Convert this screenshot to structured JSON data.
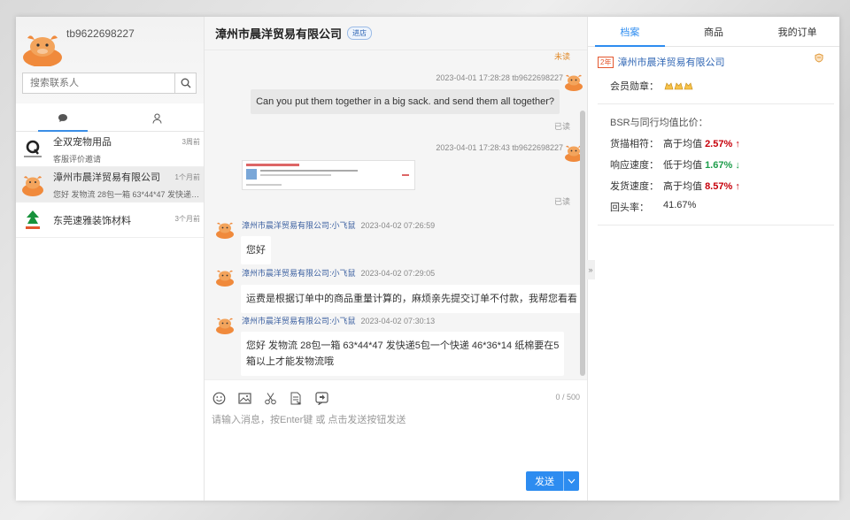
{
  "me": {
    "name": "tb9622698227"
  },
  "search": {
    "placeholder": "搜索联系人"
  },
  "contacts": [
    {
      "name": "全双宠物用品",
      "subtitle": "客服评价邀请",
      "time": "3周前"
    },
    {
      "name": "漳州市晨洋贸易有限公司",
      "subtitle": "您好 发物流 28包一箱 63*44*47 发快递5包...",
      "time": "1个月前"
    },
    {
      "name": "东莞速雅装饰材料",
      "subtitle": "",
      "time": "3个月前"
    }
  ],
  "chat": {
    "title": "漳州市晨洋贸易有限公司",
    "badge": "进店",
    "unread": "未读",
    "messages": [
      {
        "meta": "2023-04-01 17:28:28  tb9622698227",
        "text": "Can you put them together in a big sack. and send them all together?",
        "status": "已读"
      },
      {
        "meta": "2023-04-01 17:28:43  tb9622698227",
        "status": "已读"
      },
      {
        "who": "漳州市晨洋贸易有限公司:小飞鼠",
        "time": "2023-04-02 07:26:59",
        "text": "您好"
      },
      {
        "who": "漳州市晨洋贸易有限公司:小飞鼠",
        "time": "2023-04-02 07:29:05",
        "text": "运费是根据订单中的商品重量计算的，麻烦亲先提交订单不付款，我帮您看看"
      },
      {
        "who": "漳州市晨洋贸易有限公司:小飞鼠",
        "time": "2023-04-02 07:30:13",
        "text_line1": "您好  发物流 28包一箱   63*44*47     发快递5包一个快递   46*36*14    纸棉要在5",
        "text_line2": "箱以上才能发物流哦"
      }
    ],
    "counter": "0 / 500",
    "placeholder": "请输入消息，按Enter键 或 点击发送按钮发送",
    "send": "发送"
  },
  "panel": {
    "tabs": [
      "档案",
      "商品",
      "我的订单"
    ],
    "years": "2年",
    "shop": "漳州市晨洋贸易有限公司",
    "medal_label": "会员勋章：",
    "bsr_title": "BSR与同行均值比价：",
    "rows": [
      {
        "k": "货描相符：",
        "v": "高于均值 ",
        "n": "2.57%",
        "dir": "up"
      },
      {
        "k": "响应速度：",
        "v": "低于均值 ",
        "n": "1.67%",
        "dir": "down"
      },
      {
        "k": "发货速度：",
        "v": "高于均值 ",
        "n": "8.57%",
        "dir": "up"
      },
      {
        "k": "回头率：",
        "v": "41.67%",
        "n": "",
        "dir": ""
      }
    ]
  },
  "colors": {
    "accent": "#2d8cf0",
    "mascot": "#f08a3c",
    "up": "#c7000b",
    "down": "#1d9d4a"
  }
}
